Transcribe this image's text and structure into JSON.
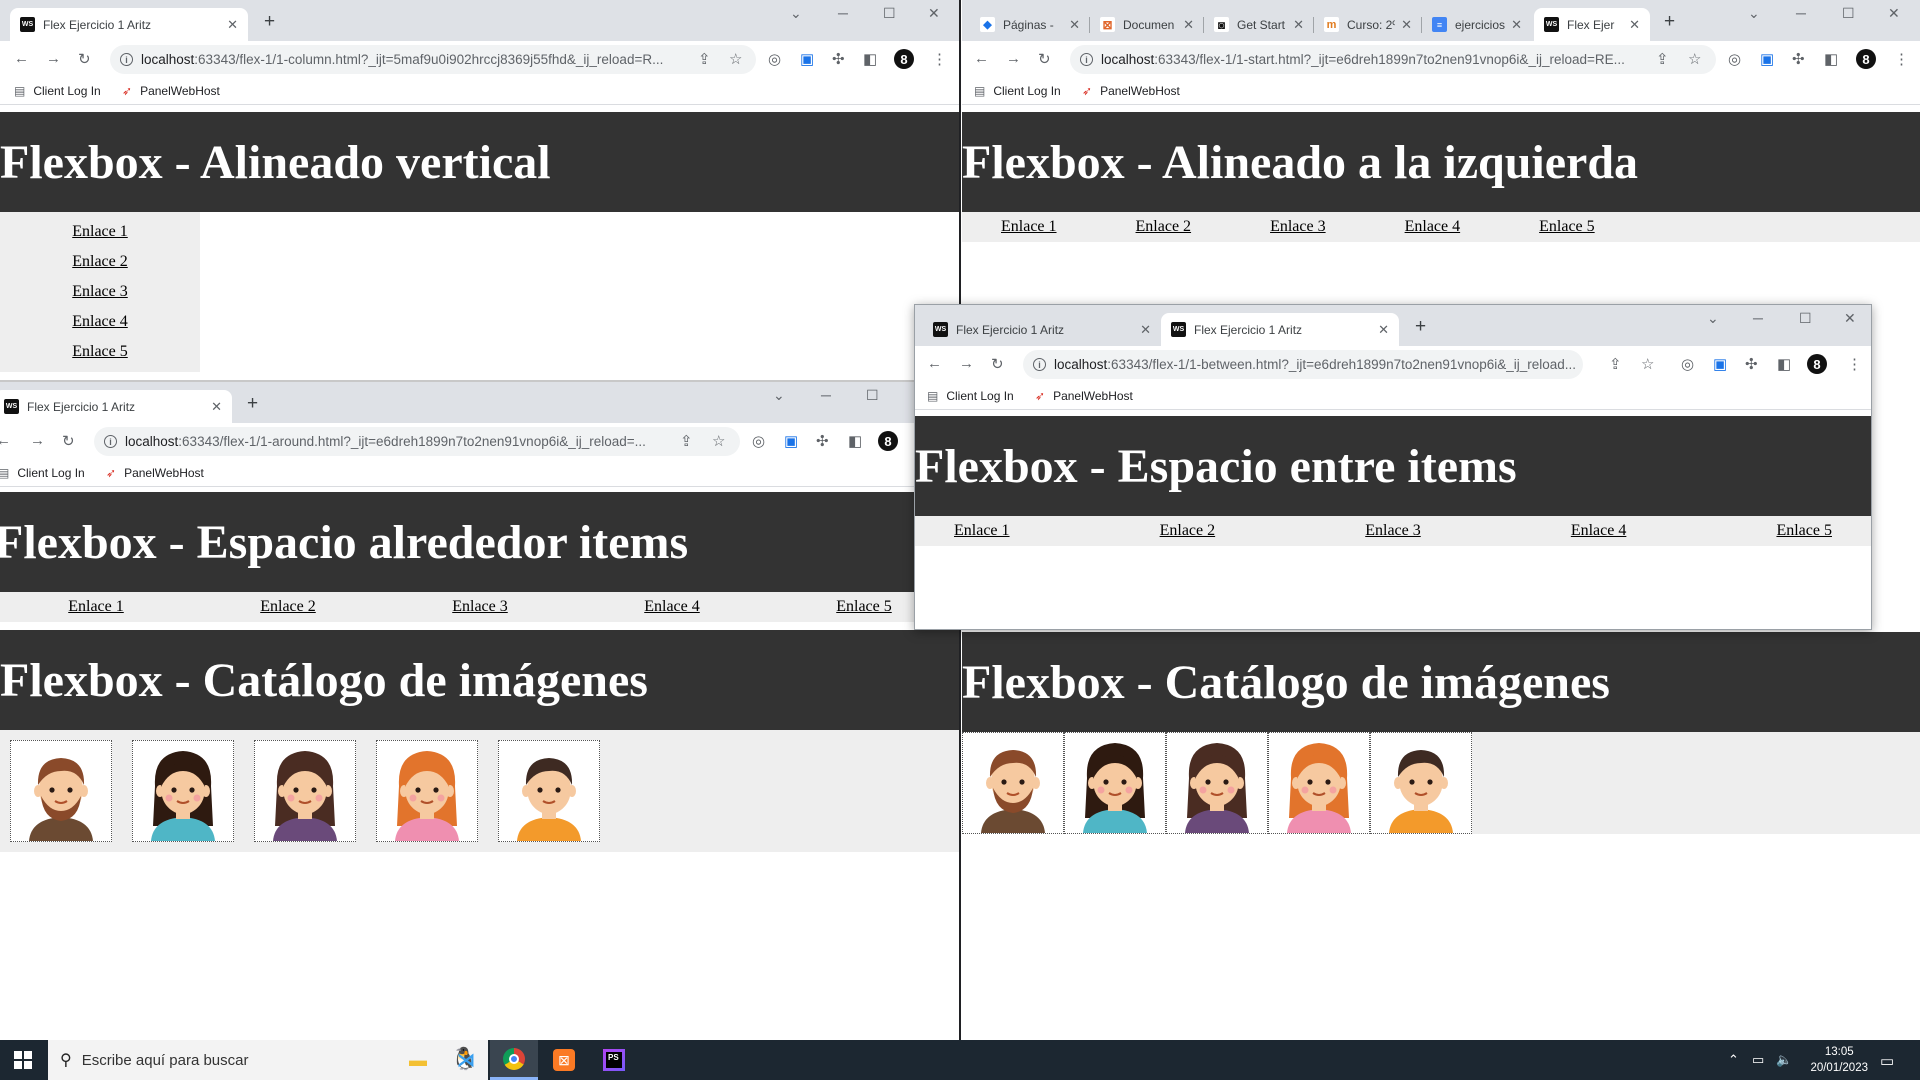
{
  "windows": {
    "column": {
      "tabs": [
        {
          "title": "Flex Ejercicio 1 Aritz",
          "favicon": "WS"
        }
      ],
      "url_main": "localhost",
      "url_rest": ":63343/flex-1/1-column.html?_ijt=5maf9u0i902hrccj8369j55fhd&_ij_reload=R...",
      "heading": "Flexbox - Alineado vertical",
      "links": [
        "Enlace 1",
        "Enlace 2",
        "Enlace 3",
        "Enlace 4",
        "Enlace 5"
      ]
    },
    "start": {
      "tabs": [
        {
          "title": "Páginas -",
          "favicon": "drive-icon"
        },
        {
          "title": "Documen",
          "favicon": "moodle-icon"
        },
        {
          "title": "Get Start",
          "favicon": "github-icon"
        },
        {
          "title": "Curso: 2º",
          "favicon": "moodle-hat-icon"
        },
        {
          "title": "ejercicios",
          "favicon": "docs-icon"
        },
        {
          "title": "Flex Ejer",
          "favicon": "WS"
        }
      ],
      "url_main": "localhost",
      "url_rest": ":63343/flex-1/1-start.html?_ijt=e6dreh1899n7to2nen91vnop6i&_ij_reload=RE...",
      "heading": "Flexbox - Alineado a la izquierda",
      "links": [
        "Enlace 1",
        "Enlace 2",
        "Enlace 3",
        "Enlace 4",
        "Enlace 5"
      ],
      "catalog_heading": "Flexbox - Catálogo de imágenes"
    },
    "around": {
      "tabs": [
        {
          "title": "Flex Ejercicio 1 Aritz",
          "favicon": "WS"
        }
      ],
      "url_main": "localhost",
      "url_rest": ":63343/flex-1/1-around.html?_ijt=e6dreh1899n7to2nen91vnop6i&_ij_reload=...",
      "heading": "Flexbox - Espacio alrededor items",
      "links": [
        "Enlace 1",
        "Enlace 2",
        "Enlace 3",
        "Enlace 4",
        "Enlace 5"
      ],
      "catalog_heading": "Flexbox - Catálogo de imágenes"
    },
    "between": {
      "tabs": [
        {
          "title": "Flex Ejercicio 1 Aritz",
          "favicon": "WS"
        },
        {
          "title": "Flex Ejercicio 1 Aritz",
          "favicon": "WS"
        }
      ],
      "url_main": "localhost",
      "url_rest": ":63343/flex-1/1-between.html?_ijt=e6dreh1899n7to2nen91vnop6i&_ij_reload...",
      "heading": "Flexbox - Espacio entre items",
      "links": [
        "Enlace 1",
        "Enlace 2",
        "Enlace 3",
        "Enlace 4",
        "Enlace 5"
      ]
    }
  },
  "bookmarks": [
    {
      "label": "Client Log In",
      "icon": "page-icon"
    },
    {
      "label": "PanelWebHost",
      "icon": "panel-icon"
    }
  ],
  "profile_badge": "8",
  "avatars": [
    {
      "name": "man-beard",
      "hair": "#8a4a2a",
      "shirt": "#6b4a32",
      "skin": "#f6c9a0"
    },
    {
      "name": "woman-dark",
      "hair": "#2e1a10",
      "shirt": "#4fb6c6",
      "skin": "#f6c9a0"
    },
    {
      "name": "woman-brown",
      "hair": "#4a2c22",
      "shirt": "#6a4a7a",
      "skin": "#f6c9a0"
    },
    {
      "name": "woman-red",
      "hair": "#e2742c",
      "shirt": "#ef8fb0",
      "skin": "#f6c9a0"
    },
    {
      "name": "boy",
      "hair": "#3e2a22",
      "shirt": "#f39a2b",
      "skin": "#f6c9a0"
    }
  ],
  "taskbar": {
    "search_placeholder": "Escribe aquí para buscar",
    "apps": [
      "file-explorer-icon",
      "vscode-icon",
      "chrome-icon",
      "xampp-icon",
      "phpstorm-icon"
    ],
    "time": "13:05",
    "date": "20/01/2023"
  },
  "colors": {
    "header_bg": "#333333",
    "nav_bg": "#eeeeee",
    "tabstrip": "#dee1e6",
    "taskbar": "#1c2731"
  }
}
